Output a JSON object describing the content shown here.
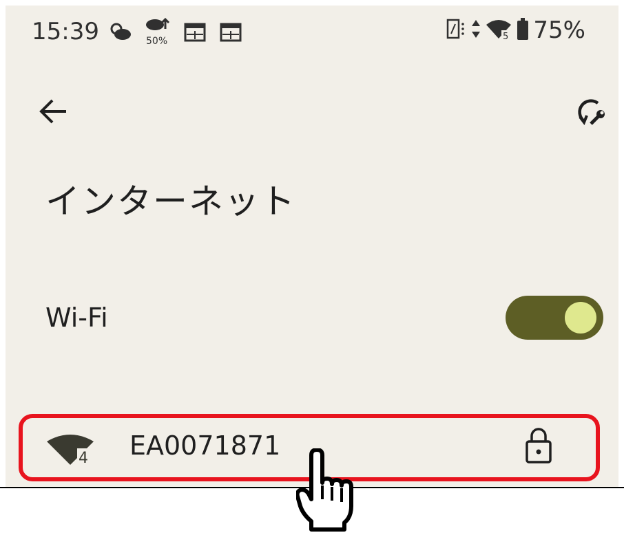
{
  "status_bar": {
    "time": "15:39",
    "battery_percent": "75%",
    "precip_percent": "50%",
    "wifi_badge": "5",
    "left_icons": [
      "weather-cloudy-icon",
      "rain-chance-icon",
      "calendar-icon",
      "calendar-icon"
    ],
    "right_icons": [
      "vibrate-icon",
      "data-arrows-icon",
      "wifi-icon",
      "battery-icon"
    ]
  },
  "header": {
    "back_icon": "arrow-left-icon",
    "action_icon": "refresh-wrench-icon"
  },
  "page": {
    "title": "インターネット"
  },
  "wifi_setting": {
    "label": "Wi-Fi",
    "enabled": true,
    "colors": {
      "track": "#5d5e25",
      "knob": "#dfe88e"
    }
  },
  "network": {
    "ssid": "EA0071871",
    "wifi_generation": "4",
    "secured": true
  },
  "annotation": {
    "highlight_color": "#e8141e",
    "pointer_icon": "hand-pointer-icon"
  }
}
